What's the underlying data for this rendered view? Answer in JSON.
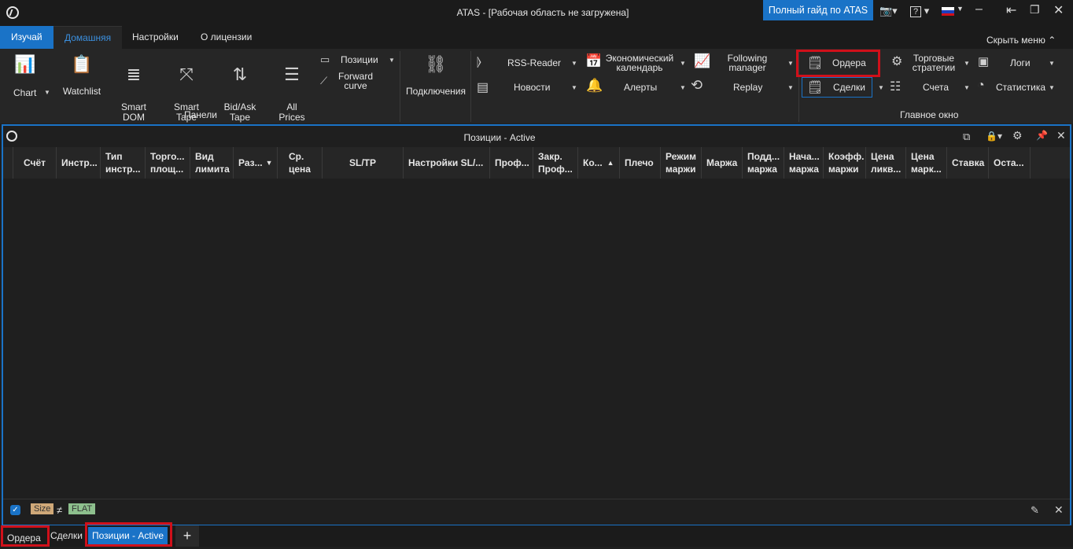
{
  "window": {
    "title": "ATAS - [Рабочая область не загружена]",
    "guide_button": "Полный гайд по ATAS"
  },
  "menu": {
    "tabs": [
      "Изучай",
      "Домашняя",
      "Настройки",
      "О лицензии"
    ],
    "hide_menu": "Скрыть меню"
  },
  "ribbon": {
    "panels_group": {
      "label": "Панели",
      "chart": "Chart",
      "watchlist": "Watchlist",
      "smart_dom": "Smart\nDOM",
      "smart_tape": "Smart\nTape",
      "bidask_tape": "Bid/Ask\nTape",
      "all_prices": "All\nPrices",
      "positions": "Позиции",
      "forward_curve": "Forward\ncurve"
    },
    "connections": "Подключения",
    "rss": "RSS-Reader",
    "news": "Новости",
    "econ_calendar": "Экономический\nкалендарь",
    "alerts": "Алерты",
    "following_manager": "Following\nmanager",
    "replay": "Replay",
    "main_window_group": {
      "label": "Главное окно",
      "orders": "Ордера",
      "trades": "Сделки",
      "trading_strategies": "Торговые\nстратегии",
      "accounts": "Счета",
      "logs": "Логи",
      "statistics": "Статистика"
    }
  },
  "panel": {
    "title": "Позиции - Active",
    "columns": [
      "Счёт",
      "Инстр...",
      "Тип\nинстр...",
      "Торго...\nплощ...",
      "Вид\nлимита",
      "Раз...",
      "Ср.\nцена",
      "SL/TP",
      "Настройки SL/...",
      "Проф...",
      "Закр.\nПроф...",
      "Ко...",
      "Плечо",
      "Режим\nмаржи",
      "Маржа",
      "Подд...\nмаржа",
      "Нача...\nмаржа",
      "Коэфф.\nмаржи",
      "Цена\nликв...",
      "Цена\nмарк...",
      "Ставка",
      "Оста..."
    ],
    "footer": {
      "size": "Size",
      "neq": "≠",
      "flat": "FLAT"
    }
  },
  "bottom_tabs": [
    "Ордера",
    "Сделки",
    "Позиции - Active",
    "+"
  ]
}
